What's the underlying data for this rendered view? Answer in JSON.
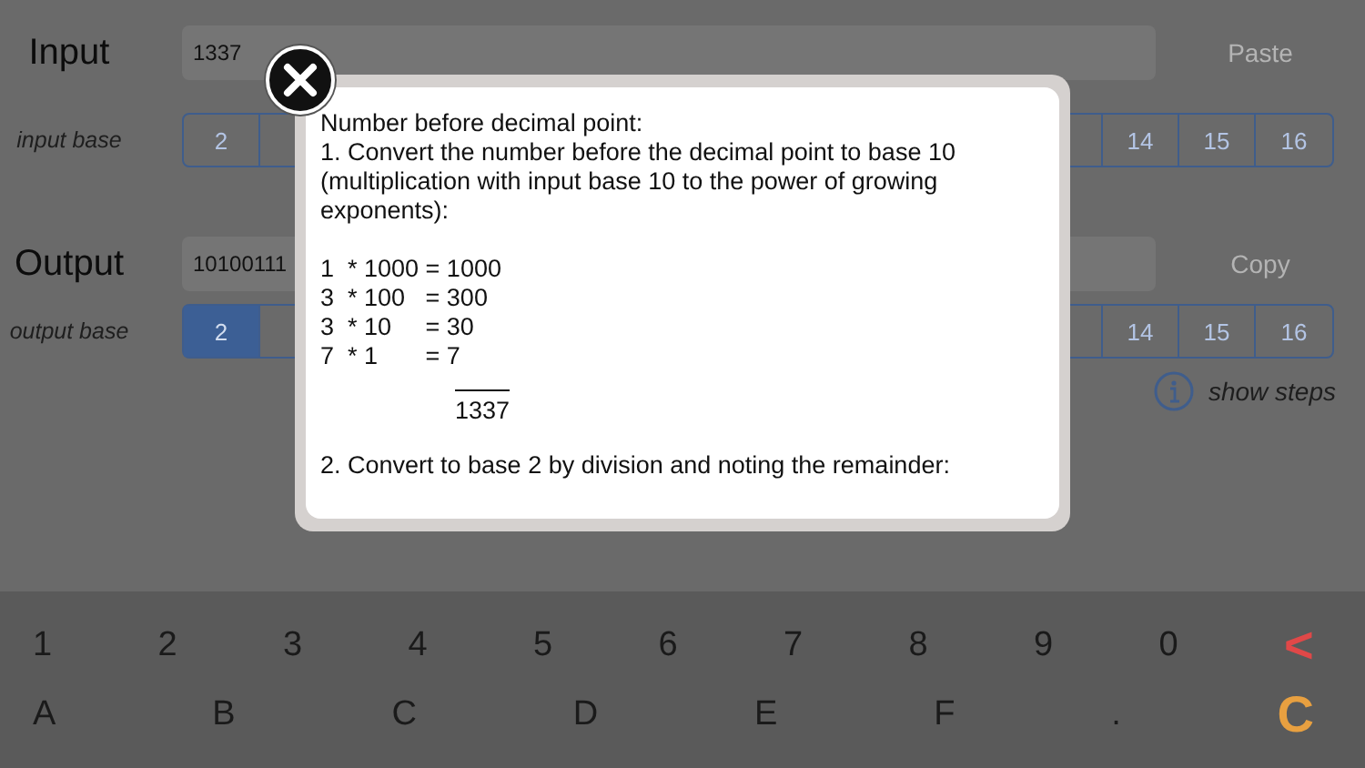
{
  "input": {
    "label": "Input",
    "value": "1337",
    "action": "Paste",
    "base_label": "input base",
    "bases": [
      {
        "label": "2",
        "selected": false
      },
      {
        "label": "14",
        "selected": false
      },
      {
        "label": "15",
        "selected": false
      },
      {
        "label": "16",
        "selected": false
      }
    ]
  },
  "output": {
    "label": "Output",
    "value": "10100111",
    "action": "Copy",
    "base_label": "output base",
    "bases": [
      {
        "label": "2",
        "selected": true
      },
      {
        "label": "14",
        "selected": false
      },
      {
        "label": "15",
        "selected": false
      },
      {
        "label": "16",
        "selected": false
      }
    ]
  },
  "show_steps": {
    "label": "show steps"
  },
  "keypad": {
    "digit_keys": [
      {
        "label": "1",
        "kind": "digit"
      },
      {
        "label": "2",
        "kind": "digit"
      },
      {
        "label": "3",
        "kind": "digit"
      },
      {
        "label": "4",
        "kind": "digit"
      },
      {
        "label": "5",
        "kind": "digit"
      },
      {
        "label": "6",
        "kind": "digit"
      },
      {
        "label": "7",
        "kind": "digit"
      },
      {
        "label": "8",
        "kind": "digit"
      },
      {
        "label": "9",
        "kind": "digit"
      },
      {
        "label": "0",
        "kind": "digit"
      },
      {
        "label": "<",
        "kind": "backspace"
      }
    ],
    "letter_keys": [
      {
        "label": "A",
        "kind": "digit"
      },
      {
        "label": "B",
        "kind": "digit"
      },
      {
        "label": "C",
        "kind": "digit"
      },
      {
        "label": "D",
        "kind": "digit"
      },
      {
        "label": "E",
        "kind": "digit"
      },
      {
        "label": "F",
        "kind": "digit"
      },
      {
        "label": ".",
        "kind": "digit"
      },
      {
        "label": "C",
        "kind": "clear"
      }
    ]
  },
  "steps_dialog": {
    "heading": "Number before decimal point:",
    "step_1": "1. Convert the number before the decimal point to base 10 (multiplication with input base 10 to the power of growing exponents):",
    "products": [
      "1  * 1000 = 1000",
      "3  * 100   = 300",
      "3  * 10     = 30",
      "7  * 1       = 7"
    ],
    "sum": "1337",
    "step_2": "2. Convert to base 2 by division and noting the remainder:"
  }
}
